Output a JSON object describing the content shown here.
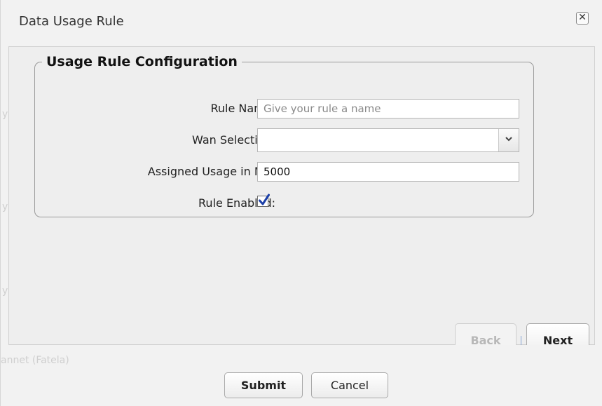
{
  "dialog": {
    "title": "Data Usage Rule",
    "close_icon": "close-icon"
  },
  "background_ghost_text": {
    "line1": "y",
    "line2": "y",
    "line3": "y",
    "bottom": "annet (Fatela)"
  },
  "config": {
    "legend": "Usage Rule Configuration",
    "rule_name": {
      "label": "Rule Name:",
      "value": "",
      "placeholder": "Give your rule a name"
    },
    "wan_selection": {
      "label": "Wan Selection:",
      "selected": "",
      "arrow_icon": "chevron-down-icon"
    },
    "assigned_usage": {
      "label": "Assigned Usage in MB:",
      "value": "5000"
    },
    "rule_enabled": {
      "label": "Rule Enabled:",
      "checked": true,
      "check_icon": "checkmark-icon"
    }
  },
  "wizard": {
    "back_label": "Back",
    "next_label": "Next"
  },
  "footer": {
    "submit_label": "Submit",
    "cancel_label": "Cancel"
  }
}
